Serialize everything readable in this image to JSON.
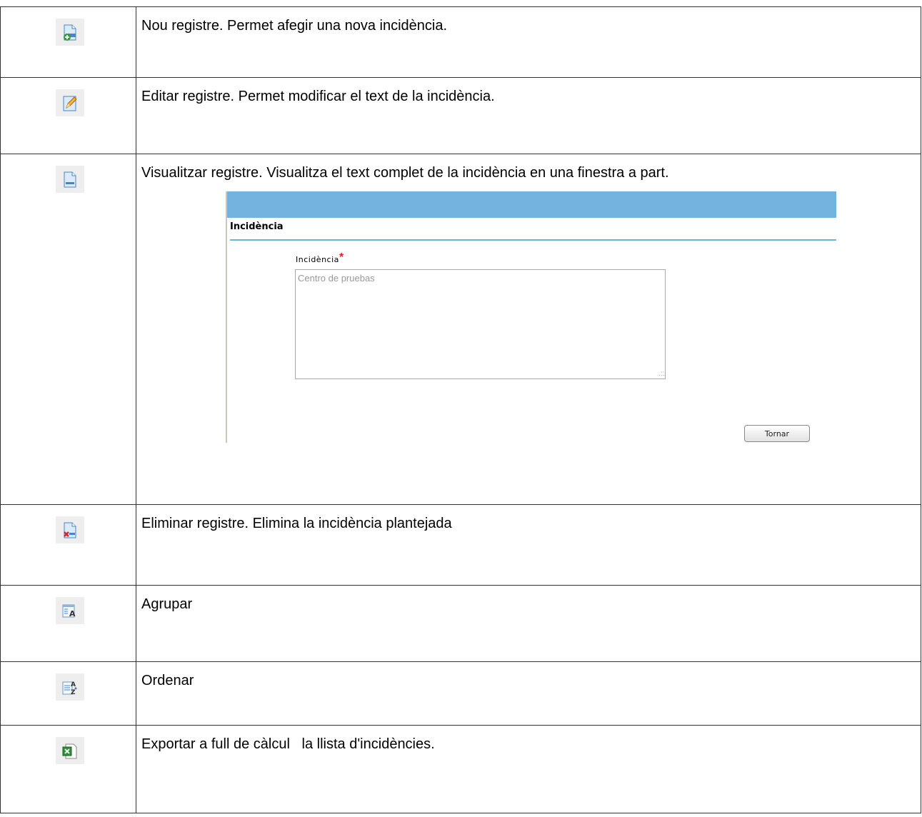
{
  "rows": [
    {
      "icon": "new-record-icon",
      "text": "Nou registre. Permet afegir una nova incidència."
    },
    {
      "icon": "edit-record-icon",
      "text": "Editar registre. Permet modificar el text de la incidència."
    },
    {
      "icon": "view-record-icon",
      "text": "Visualitzar registre. Visualitza el text complet de la incidència en una finestra a part."
    },
    {
      "icon": "delete-record-icon",
      "text": "Eliminar registre. Elimina la incidència plantejada"
    },
    {
      "icon": "group-icon",
      "text": "Agrupar"
    },
    {
      "icon": "sort-icon",
      "text": "Ordenar"
    },
    {
      "icon": "export-spreadsheet-icon",
      "text": "Exportar a full de càlcul   la llista d'incidèncie​s."
    }
  ],
  "embedded": {
    "title": "Incidència",
    "field_label": "Incidència",
    "required_mark": "*",
    "field_value": "Centro de pruebas",
    "button_label": "Tornar"
  },
  "colors": {
    "header_bar": "#74b3df",
    "rule": "#69b4d7",
    "required": "#e02020"
  }
}
